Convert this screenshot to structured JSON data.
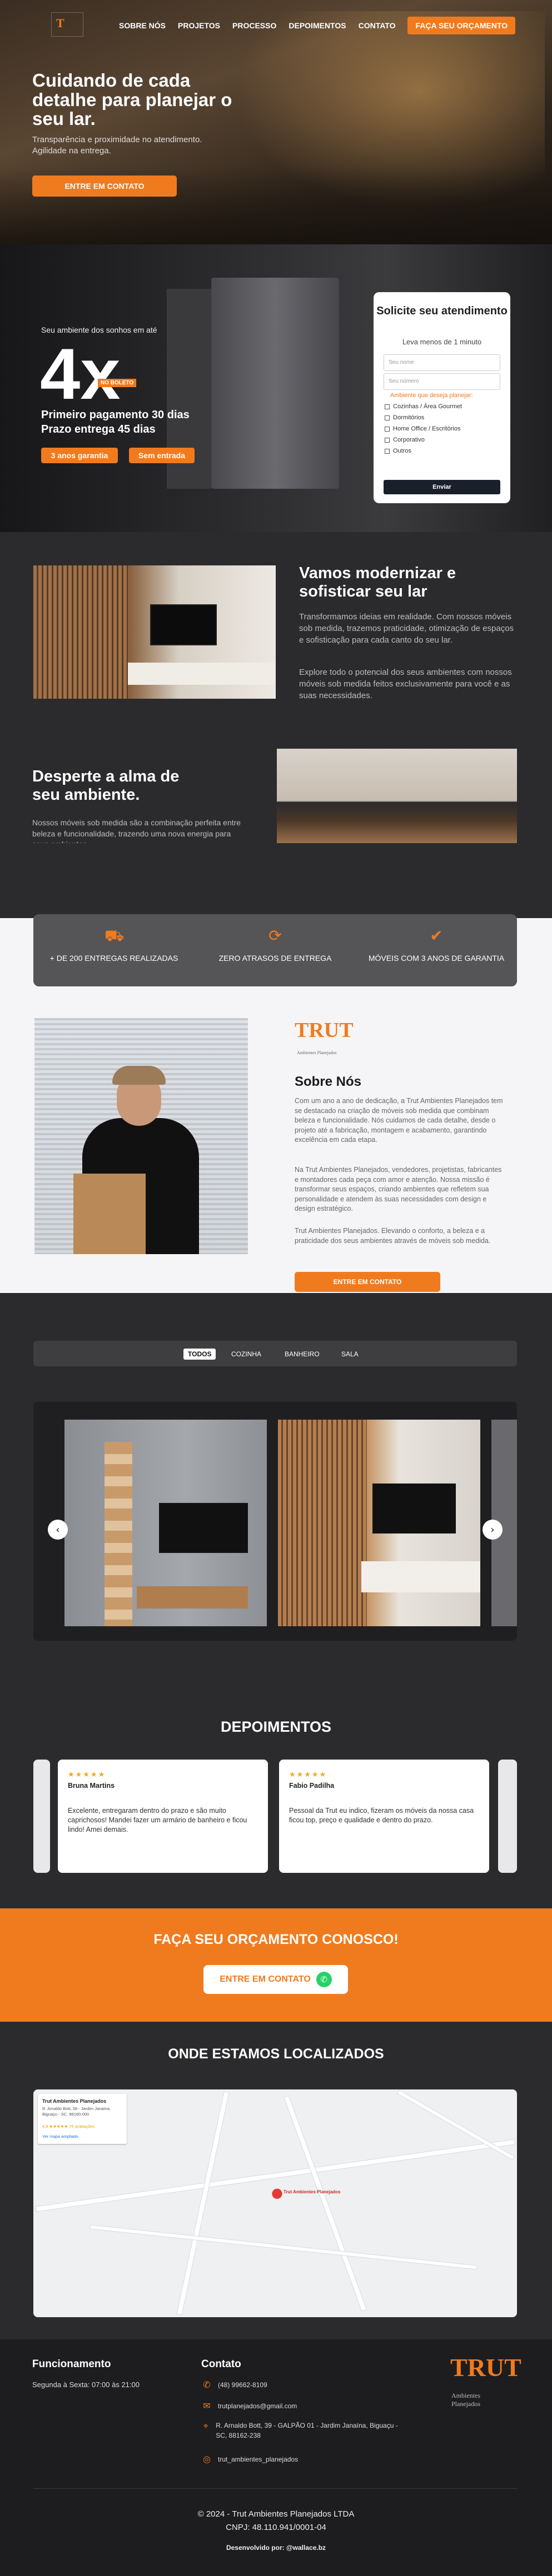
{
  "header": {
    "nav": [
      "SOBRE NÓS",
      "PROJETOS",
      "PROCESSO",
      "DEPOIMENTOS",
      "CONTATO"
    ],
    "cta": "FAÇA SEU ORÇAMENTO"
  },
  "hero": {
    "title": "Cuidando de cada detalhe para planejar o seu lar.",
    "subtitle": "Transparência e proximidade no atendimento. Agilidade na entrega.",
    "button": "ENTRE EM CONTATO"
  },
  "promo": {
    "pre": "Seu ambiente dos sonhos em até",
    "big": "4x",
    "badge": "NO BOLETO",
    "line1": "Primeiro pagamento 30 dias",
    "line2": "Prazo entrega 45 dias",
    "pill1": "3 anos garantia",
    "pill2": "Sem entrada"
  },
  "form": {
    "title": "Solicite seu atendimento",
    "lead": "Leva menos de 1 minuto",
    "name_ph": "Seu nome",
    "phone_ph": "Seu número",
    "question": "Ambiente que deseja planejar:",
    "options": [
      "Cozinhas / Área Gourmet",
      "Dormitórios",
      "Home Office / Escritórios",
      "Corporativo",
      "Outros"
    ],
    "send": "Enviar"
  },
  "modern": {
    "title": "Vamos modernizar e sofisticar seu lar",
    "p1": "Transformamos ideias em realidade. Com nossos móveis sob medida, trazemos praticidade, otimização de espaços e sofisticação para cada canto do seu lar.",
    "p2": "Explore todo o potencial dos seus ambientes com nossos móveis sob medida feitos exclusivamente para você e as suas necessidades.",
    "title2": "Desperte a alma de seu ambiente.",
    "p3": "Nossos móveis sob medida são a combinação perfeita entre beleza e funcionalidade, trazendo uma nova energia para seus ambientes."
  },
  "stats": [
    {
      "icon": "truck-icon",
      "text": "+ DE 200 ENTREGAS REALIZADAS"
    },
    {
      "icon": "clock-icon",
      "text": "ZERO ATRASOS DE ENTREGA"
    },
    {
      "icon": "check-circle-icon",
      "text": "MÓVEIS COM 3 ANOS DE GARANTIA"
    }
  ],
  "about": {
    "logo": "TRUT",
    "logo_sub": "Ambientes Planejados",
    "title": "Sobre Nós",
    "p1": "Com um ano a ano de dedicação, a Trut Ambientes Planejados tem se destacado na criação de móveis sob medida que combinam beleza e funcionalidade. Nós cuidamos de cada detalhe, desde o projeto até a fabricação, montagem e acabamento, garantindo excelência em cada etapa.",
    "p2": "Na Trut Ambientes Planejados, vendedores, projetistas, fabricantes e montadores cada peça com amor e atenção. Nossa missão é transformar seus espaços, criando ambientes que refletem sua personalidade e atendem às suas necessidades com design e design estratégico.",
    "p3": "Trut Ambientes Planejados. Elevando o conforto, a beleza e a praticidade dos seus ambientes através de móveis sob medida.",
    "button": "ENTRE EM CONTATO"
  },
  "gallery": {
    "tabs": [
      "TODOS",
      "COZINHA",
      "BANHEIRO",
      "SALA"
    ]
  },
  "testimonials": {
    "title": "DEPOIMENTOS",
    "items": [
      {
        "stars": "★★★★★",
        "name": "Bruna Martins",
        "text": "Excelente, entregaram dentro do prazo e são muito caprichosos! Mandei fazer um armário de banheiro e ficou lindo! Amei demais."
      },
      {
        "stars": "★★★★★",
        "name": "Fabio Padilha",
        "text": "Pessoal da Trut eu indico, fizeram os móveis da nossa casa ficou top, preço e qualidade e dentro do prazo."
      }
    ]
  },
  "cta": {
    "title": "FAÇA SEU ORÇAMENTO CONOSCO!",
    "button": "ENTRE EM CONTATO"
  },
  "map": {
    "title": "ONDE ESTAMOS LOCALIZADOS",
    "card_title": "Trut Ambientes Planejados",
    "card_addr": "R. Arnaldo Bott, 39 - Jardim Janaína, Biguaçu - SC, 88160-000",
    "card_rating": "4,9 ★★★★★ 75 avaliações",
    "card_link": "Ver mapa ampliado",
    "pin_label": "Trut Ambientes Planejados"
  },
  "footer": {
    "h1": "Funcionamento",
    "hours": "Segunda à Sexta: 07:00 às 21:00",
    "h2": "Contato",
    "phone": "(48) 99662-8109",
    "email": "trutplanejados@gmail.com",
    "address": "R. Arnaldo Bott, 39 - GALPÃO 01 - Jardim Janaína, Biguaçu - SC, 88162-238",
    "instagram": "trut_ambientes_planejados",
    "logo": "TRUT",
    "logo_sub": "Ambientes Planejados",
    "copyright": "© 2024 - Trut Ambientes Planejados LTDA",
    "cnpj": "CNPJ: 48.110.941/0001-04",
    "dev": "Desenvolvido por: @wallace.bz"
  }
}
